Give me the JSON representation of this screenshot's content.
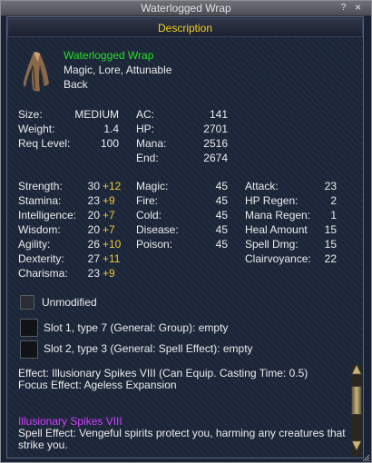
{
  "window": {
    "title": "Waterlogged Wrap",
    "help_label": "?",
    "close_label": "×"
  },
  "header": {
    "label": "Description"
  },
  "item": {
    "icon": "cloak-icon",
    "name": "Waterlogged Wrap",
    "flags": "Magic, Lore, Attunable",
    "slot": "Back"
  },
  "basic_left": [
    {
      "label": "Size:",
      "value": "MEDIUM"
    },
    {
      "label": "Weight:",
      "value": "1.4"
    },
    {
      "label": "Req Level:",
      "value": "100"
    }
  ],
  "basic_right": [
    {
      "label": "AC:",
      "value": "141"
    },
    {
      "label": "HP:",
      "value": "2701"
    },
    {
      "label": "Mana:",
      "value": "2516"
    },
    {
      "label": "End:",
      "value": "2674"
    }
  ],
  "stats": [
    {
      "label": "Strength:",
      "value": "30",
      "bonus": "+12"
    },
    {
      "label": "Stamina:",
      "value": "23",
      "bonus": "+9"
    },
    {
      "label": "Intelligence:",
      "value": "20",
      "bonus": "+7"
    },
    {
      "label": "Wisdom:",
      "value": "20",
      "bonus": "+7"
    },
    {
      "label": "Agility:",
      "value": "26",
      "bonus": "+10"
    },
    {
      "label": "Dexterity:",
      "value": "27",
      "bonus": "+11"
    },
    {
      "label": "Charisma:",
      "value": "23",
      "bonus": "+9"
    }
  ],
  "resists": [
    {
      "label": "Magic:",
      "value": "45"
    },
    {
      "label": "Fire:",
      "value": "45"
    },
    {
      "label": "Cold:",
      "value": "45"
    },
    {
      "label": "Disease:",
      "value": "45"
    },
    {
      "label": "Poison:",
      "value": "45"
    }
  ],
  "combat": [
    {
      "label": "Attack:",
      "value": "23"
    },
    {
      "label": "HP Regen:",
      "value": "2"
    },
    {
      "label": "Mana Regen:",
      "value": "1"
    },
    {
      "label": "Heal Amount",
      "value": "15"
    },
    {
      "label": "Spell Dmg:",
      "value": "15"
    },
    {
      "label": "Clairvoyance:",
      "value": "22"
    }
  ],
  "unmodified": {
    "label": "Unmodified",
    "checked": false
  },
  "aug_slots": [
    {
      "label": "Slot 1, type 7 (General: Group): empty"
    },
    {
      "label": "Slot 2, type 3 (General: Spell Effect): empty"
    }
  ],
  "effect": "Effect: Illusionary Spikes VIII (Can Equip. Casting Time: 0.5)",
  "focus_effect": "Focus Effect: Ageless Expansion",
  "spell": {
    "name": "Illusionary Spikes VIII",
    "effect_line1": "Spell Effect: Vengeful spirits protect you, harming any creatures that",
    "effect_line2": "strike you."
  },
  "colors": {
    "name": "#24e024",
    "header": "#f2d020",
    "bonus": "#e8c83a",
    "spell": "#d040ff"
  }
}
